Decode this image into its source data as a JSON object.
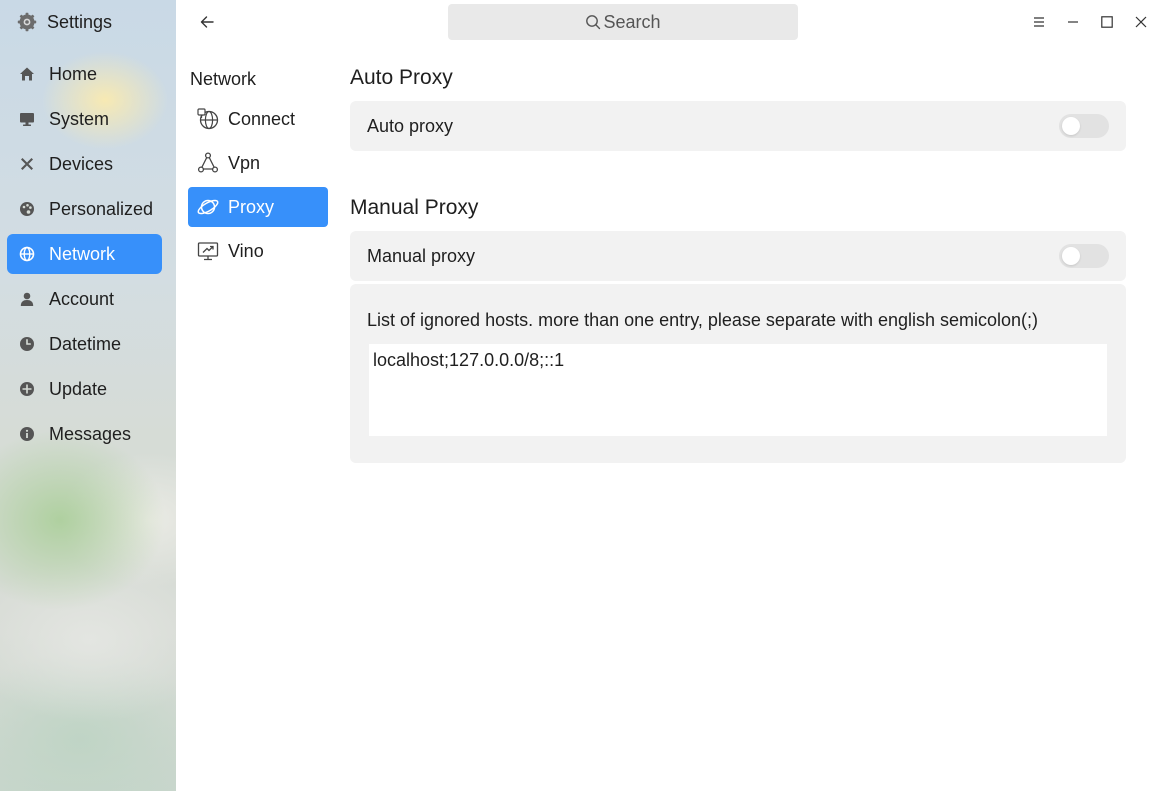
{
  "app": {
    "title": "Settings",
    "icon": "gear-icon"
  },
  "sidebar": {
    "items": [
      {
        "label": "Home",
        "icon": "home-icon"
      },
      {
        "label": "System",
        "icon": "monitor-icon"
      },
      {
        "label": "Devices",
        "icon": "tools-icon"
      },
      {
        "label": "Personalized",
        "icon": "palette-icon"
      },
      {
        "label": "Network",
        "icon": "globe-icon",
        "active": true
      },
      {
        "label": "Account",
        "icon": "user-icon"
      },
      {
        "label": "Datetime",
        "icon": "clock-icon"
      },
      {
        "label": "Update",
        "icon": "update-icon"
      },
      {
        "label": "Messages",
        "icon": "info-icon"
      }
    ]
  },
  "header": {
    "search_placeholder": "Search"
  },
  "subnav": {
    "title": "Network",
    "items": [
      {
        "label": "Connect",
        "icon": "connect-globe-icon"
      },
      {
        "label": "Vpn",
        "icon": "vpn-icon"
      },
      {
        "label": "Proxy",
        "icon": "planet-icon",
        "active": true
      },
      {
        "label": "Vino",
        "icon": "remote-desktop-icon"
      }
    ]
  },
  "auto_proxy": {
    "section_title": "Auto Proxy",
    "label": "Auto proxy",
    "enabled": false
  },
  "manual_proxy": {
    "section_title": "Manual Proxy",
    "label": "Manual proxy",
    "enabled": false,
    "ignored_hosts_label": "List of ignored hosts. more than one entry, please separate with english semicolon(;)",
    "ignored_hosts_value": "localhost;127.0.0.0/8;::1"
  },
  "colors": {
    "accent": "#3790fa",
    "card_bg": "#f2f2f2",
    "toggle_off": "#e2e2e2"
  }
}
